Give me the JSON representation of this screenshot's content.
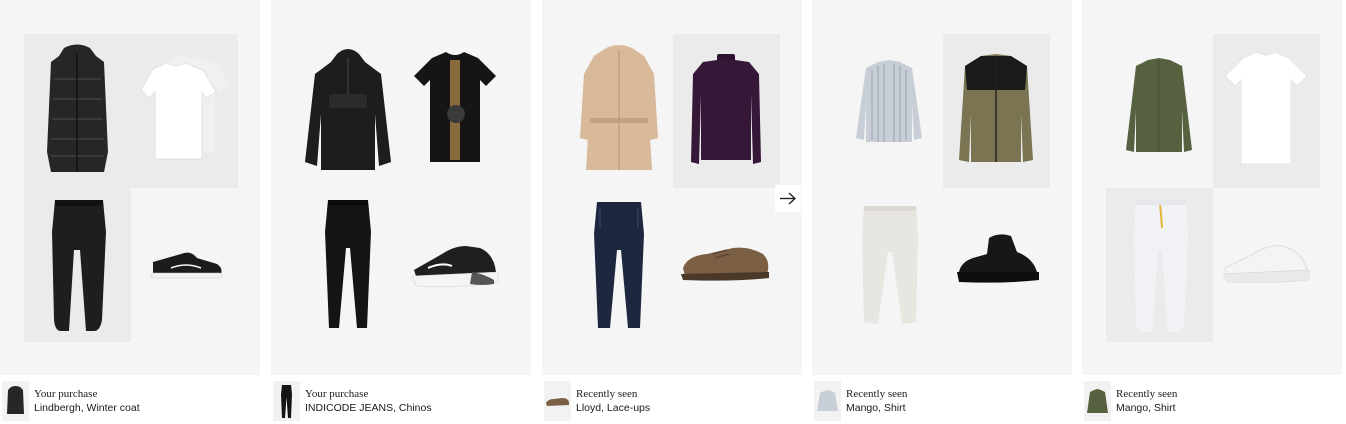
{
  "outfits": [
    {
      "label": "Your purchase",
      "product": "Lindbergh, Winter coat",
      "items": [
        "black-puffer-coat",
        "white-t-shirts",
        "black-joggers",
        "black-sneaker"
      ],
      "thumb": "black-puffer-coat"
    },
    {
      "label": "Your purchase",
      "product": "INDICODE JEANS, Chinos",
      "items": [
        "black-hooded-jacket",
        "black-printed-t-shirt",
        "black-chinos",
        "black-running-sneaker"
      ],
      "thumb": "black-chinos"
    },
    {
      "label": "Recently seen",
      "product": "Lloyd, Lace-ups",
      "items": [
        "beige-trench-coat",
        "purple-turtleneck",
        "dark-blue-jeans",
        "brown-lace-up-shoe"
      ],
      "thumb": "brown-lace-up-shoe"
    },
    {
      "label": "Recently seen",
      "product": "Mango, Shirt",
      "items": [
        "striped-shirt",
        "olive-fleece-jacket",
        "white-trousers",
        "black-high-top-sneaker"
      ],
      "thumb": "striped-shirt"
    },
    {
      "label": "Recently seen",
      "product": "Mango, Shirt",
      "items": [
        "green-shirt",
        "white-t-shirt",
        "white-joggers",
        "white-sneaker"
      ],
      "thumb": "green-shirt"
    }
  ],
  "navigation": {
    "next_icon": "arrow-right-icon"
  },
  "colors": {
    "panel": "#f5f5f5",
    "tile_shade": "#ebebeb",
    "text": "#1a1a1a"
  }
}
